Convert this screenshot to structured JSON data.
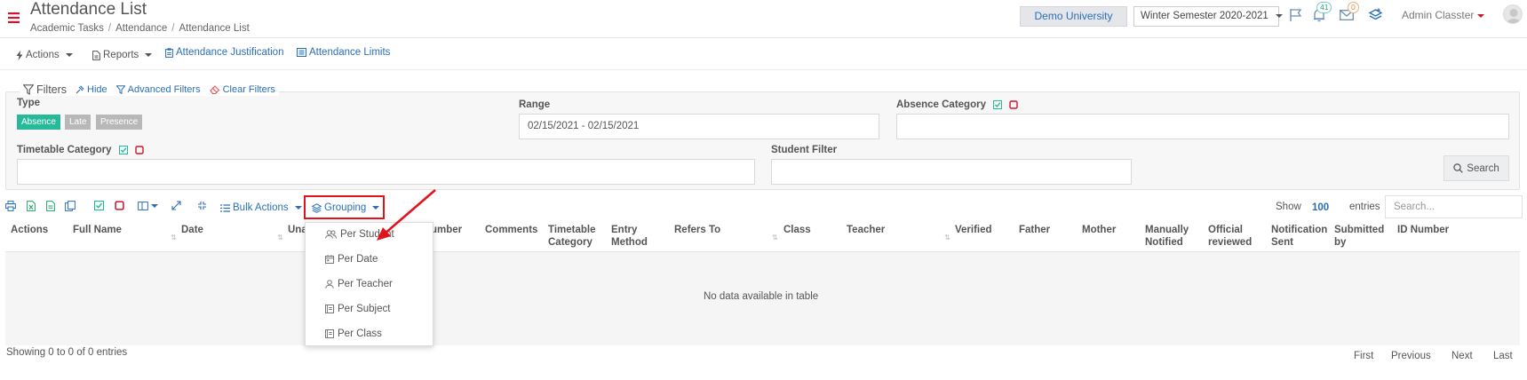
{
  "header": {
    "title": "Attendance List",
    "breadcrumb": [
      "Academic Tasks",
      "Attendance",
      "Attendance List"
    ],
    "university": "Demo University",
    "semester": "Winter Semester 2020-2021",
    "notifications_count": "41",
    "messages_count": "0",
    "user": "Admin Classter"
  },
  "toolbar": {
    "actions": "Actions",
    "reports": "Reports",
    "justification": "Attendance Justification",
    "limits": "Attendance Limits"
  },
  "filters": {
    "title": "Filters",
    "hide": "Hide",
    "advanced": "Advanced Filters",
    "clear": "Clear Filters",
    "type_label": "Type",
    "type_options": [
      "Absence",
      "Late",
      "Presence"
    ],
    "range_label": "Range",
    "range_value": "02/15/2021 - 02/15/2021",
    "absence_category_label": "Absence Category",
    "timetable_category_label": "Timetable Category",
    "student_filter_label": "Student Filter",
    "search_button": "Search"
  },
  "table_toolbar": {
    "bulk_actions": "Bulk Actions",
    "grouping": "Grouping",
    "show": "Show",
    "page_size": "100",
    "entries": "entries",
    "search_placeholder": "Search..."
  },
  "grouping_menu": [
    "Per Student",
    "Per Date",
    "Per Teacher",
    "Per Subject",
    "Per Class"
  ],
  "table": {
    "columns": {
      "actions": "Actions",
      "full_name": "Full Name",
      "date": "Date",
      "una": "Una",
      "number": "umber",
      "comments": "Comments",
      "timetable_cat_1": "Timetable",
      "timetable_cat_2": "Category",
      "entry_method_1": "Entry",
      "entry_method_2": "Method",
      "refers_to": "Refers To",
      "class": "Class",
      "teacher": "Teacher",
      "verified": "Verified",
      "father": "Father",
      "mother": "Mother",
      "manually_1": "Manually",
      "manually_2": "Notified",
      "official_1": "Official",
      "official_2": "reviewed",
      "notification_1": "Notification",
      "notification_2": "Sent",
      "submitted_1": "Submitted",
      "submitted_2": "by",
      "id_number": "ID Number"
    },
    "empty_message": "No data available in table",
    "info": "Showing 0 to 0 of 0 entries",
    "pagination": [
      "First",
      "Previous",
      "Next",
      "Last"
    ]
  },
  "colors": {
    "accent_blue": "#2a6fb5",
    "absence_green": "#26b99a",
    "chip_grey": "#b8b8b8",
    "highlight_red": "#e3131e",
    "menu_red": "#d0142c"
  }
}
